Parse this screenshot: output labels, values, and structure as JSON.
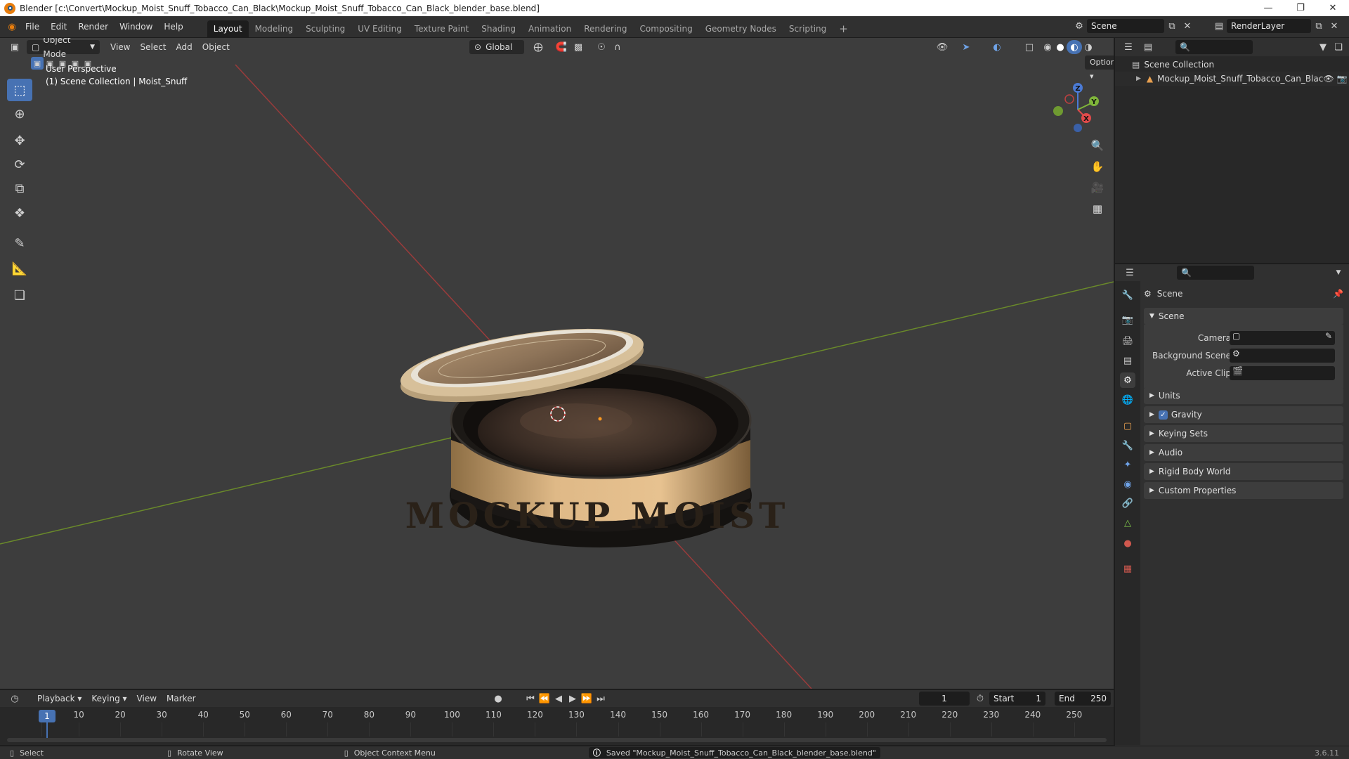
{
  "window": {
    "title": "Blender [c:\\Convert\\Mockup_Moist_Snuff_Tobacco_Can_Black\\Mockup_Moist_Snuff_Tobacco_Can_Black_blender_base.blend]"
  },
  "menus": [
    "File",
    "Edit",
    "Render",
    "Window",
    "Help"
  ],
  "workspaces": [
    "Layout",
    "Modeling",
    "Sculpting",
    "UV Editing",
    "Texture Paint",
    "Shading",
    "Animation",
    "Rendering",
    "Compositing",
    "Geometry Nodes",
    "Scripting"
  ],
  "active_workspace": "Layout",
  "scene_selector": {
    "value": "Scene"
  },
  "view_layer": {
    "value": "RenderLayer"
  },
  "viewport": {
    "mode": "Object Mode",
    "menus": [
      "View",
      "Select",
      "Add",
      "Object"
    ],
    "orientation": "Global",
    "options_label": "Options",
    "overlay_line1": "User Perspective",
    "overlay_line2": "(1) Scene Collection | Moist_Snuff",
    "can_text": "MOCKUP MOIST",
    "gizmo": {
      "z": "Z",
      "y": "Y",
      "x": "X"
    }
  },
  "outliner": {
    "root": "Scene Collection",
    "items": [
      {
        "label": "Mockup_Moist_Snuff_Tobacco_Can_Blac"
      }
    ]
  },
  "properties": {
    "header": "Scene",
    "panel_scene": "Scene",
    "fields": [
      {
        "label": "Camera"
      },
      {
        "label": "Background Scene"
      },
      {
        "label": "Active Clip"
      }
    ],
    "panels": [
      "Units",
      "Gravity",
      "Keying Sets",
      "Audio",
      "Rigid Body World",
      "Custom Properties"
    ],
    "gravity_checked": true
  },
  "timeline": {
    "menus": [
      "Playback",
      "Keying",
      "View",
      "Marker"
    ],
    "current_frame": "1",
    "start_label": "Start",
    "start": "1",
    "end_label": "End",
    "end": "250",
    "ruler": [
      "1",
      "10",
      "20",
      "30",
      "40",
      "50",
      "60",
      "70",
      "80",
      "90",
      "100",
      "110",
      "120",
      "130",
      "140",
      "150",
      "160",
      "170",
      "180",
      "190",
      "200",
      "210",
      "220",
      "230",
      "240",
      "250"
    ]
  },
  "statusbar": {
    "select": "Select",
    "rotate": "Rotate View",
    "context": "Object Context Menu",
    "message": "Saved \"Mockup_Moist_Snuff_Tobacco_Can_Black_blender_base.blend\"",
    "version": "3.6.11"
  }
}
